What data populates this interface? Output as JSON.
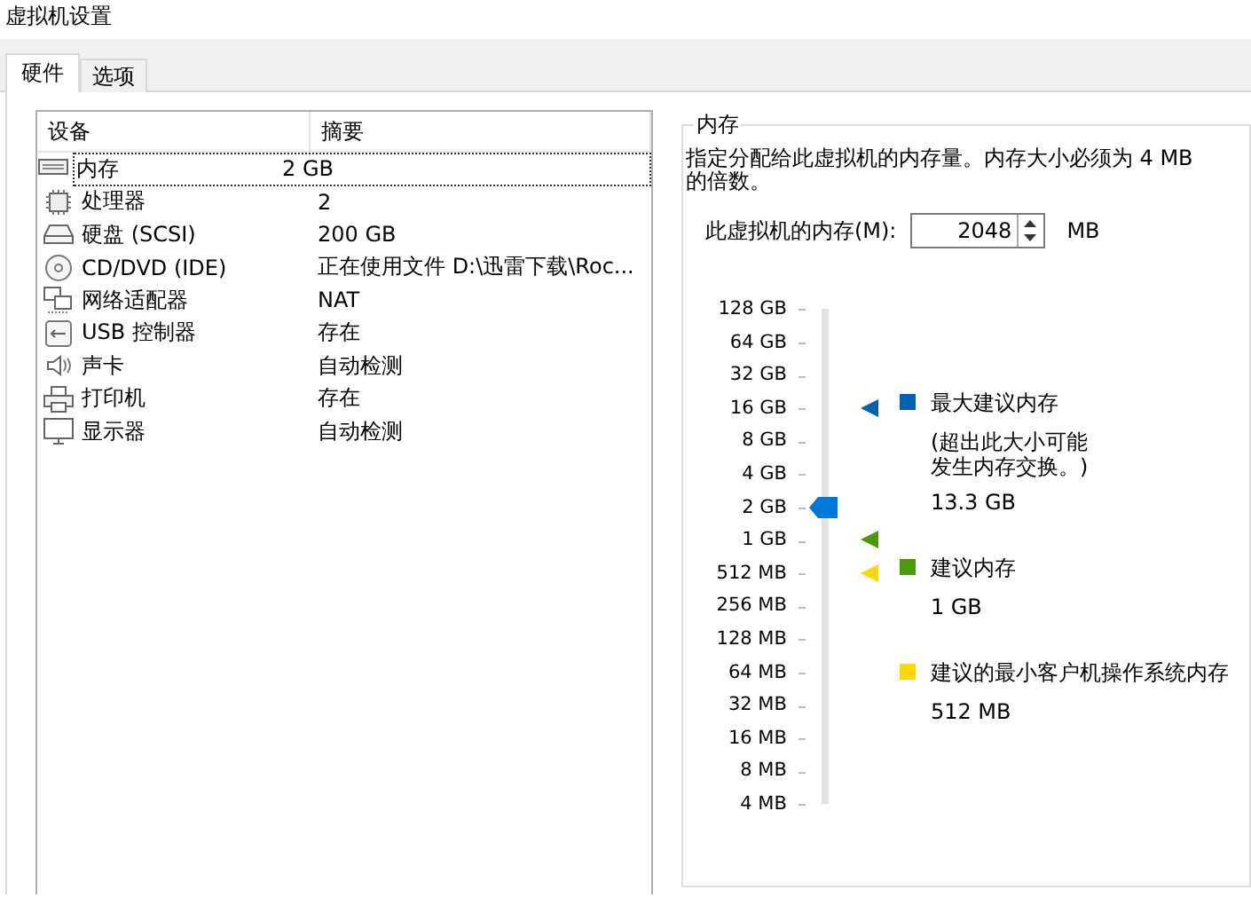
{
  "window": {
    "title": "虚拟机设置"
  },
  "tabs": [
    {
      "label": "硬件",
      "selected": true
    },
    {
      "label": "选项",
      "selected": false
    }
  ],
  "device_table": {
    "columns": [
      "设备",
      "摘要"
    ],
    "rows": [
      {
        "kind": "memory",
        "device": "内存",
        "summary": "2 GB",
        "selected": true
      },
      {
        "kind": "cpu",
        "device": "处理器",
        "summary": "2",
        "selected": false
      },
      {
        "kind": "disk",
        "device": "硬盘 (SCSI)",
        "summary": "200 GB",
        "selected": false
      },
      {
        "kind": "cd",
        "device": "CD/DVD (IDE)",
        "summary": "正在使用文件 D:\\迅雷下载\\Roc...",
        "selected": false
      },
      {
        "kind": "network",
        "device": "网络适配器",
        "summary": "NAT",
        "selected": false
      },
      {
        "kind": "usb",
        "device": "USB 控制器",
        "summary": "存在",
        "selected": false
      },
      {
        "kind": "sound",
        "device": "声卡",
        "summary": "自动检测",
        "selected": false
      },
      {
        "kind": "printer",
        "device": "打印机",
        "summary": "存在",
        "selected": false
      },
      {
        "kind": "display",
        "device": "显示器",
        "summary": "自动检测",
        "selected": false
      }
    ]
  },
  "memory_panel": {
    "title": "内存",
    "description": "指定分配给此虚拟机的内存量。内存大小必须为 4 MB 的倍数。",
    "field_label": "此虚拟机的内存(M):",
    "value": "2048",
    "unit": "MB",
    "slider": {
      "ticks": [
        "128 GB",
        "64 GB",
        "32 GB",
        "16 GB",
        "8 GB",
        "4 GB",
        "2 GB",
        "1 GB",
        "512 MB",
        "256 MB",
        "128 MB",
        "64 MB",
        "32 MB",
        "16 MB",
        "8 MB",
        "4 MB"
      ],
      "level": 0.6,
      "markers": [
        {
          "color": "#0063b1",
          "level": 0.8
        },
        {
          "color": "#4a9a0c",
          "level": 0.5333
        },
        {
          "color": "#ffd800",
          "level": 0.4667
        }
      ]
    },
    "legend": [
      {
        "color": "#0063b1",
        "title": "最大建议内存",
        "note": "(超出此大小可能发生内存交换。)",
        "value": "13.3 GB"
      },
      {
        "color": "#4a9a0c",
        "title": "建议内存",
        "value": "1 GB"
      },
      {
        "color": "#ffd800",
        "title": "建议的最小客户机操作系统内存",
        "value": "512 MB"
      }
    ]
  }
}
